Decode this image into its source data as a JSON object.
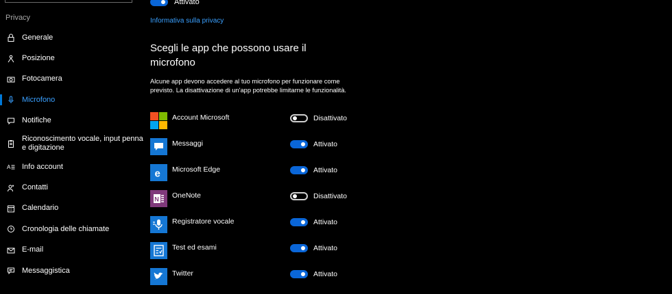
{
  "sidebar": {
    "section_label": "Privacy",
    "items": [
      {
        "label": "Generale",
        "icon": "lock-icon"
      },
      {
        "label": "Posizione",
        "icon": "location-person-icon"
      },
      {
        "label": "Fotocamera",
        "icon": "camera-icon"
      },
      {
        "label": "Microfono",
        "icon": "microphone-icon",
        "active": true
      },
      {
        "label": "Notifiche",
        "icon": "notifications-icon"
      },
      {
        "label": "Riconoscimento vocale, input penna e digitazione",
        "icon": "clipboard-icon"
      },
      {
        "label": "Info account",
        "icon": "account-info-icon"
      },
      {
        "label": "Contatti",
        "icon": "contacts-icon"
      },
      {
        "label": "Calendario",
        "icon": "calendar-icon"
      },
      {
        "label": "Cronologia delle chiamate",
        "icon": "call-history-icon"
      },
      {
        "label": "E-mail",
        "icon": "mail-icon"
      },
      {
        "label": "Messaggistica",
        "icon": "messaging-icon"
      }
    ]
  },
  "main": {
    "top_toggle": {
      "state": "on",
      "label": "Attivato"
    },
    "privacy_link": "Informativa sulla privacy",
    "heading": "Scegli le app che possono usare il microfono",
    "description": "Alcune app devono accedere al tuo microfono per funzionare come previsto. La disattivazione di un'app potrebbe limitarne le funzionalità.",
    "apps": [
      {
        "name": "Account Microsoft",
        "state": "off",
        "status": "Disattivato",
        "icon": "microsoft-logo-icon"
      },
      {
        "name": "Messaggi",
        "state": "on",
        "status": "Attivato",
        "icon": "messages-icon"
      },
      {
        "name": "Microsoft Edge",
        "state": "on",
        "status": "Attivato",
        "icon": "edge-icon"
      },
      {
        "name": "OneNote",
        "state": "off",
        "status": "Disattivato",
        "icon": "onenote-icon"
      },
      {
        "name": "Registratore vocale",
        "state": "on",
        "status": "Attivato",
        "icon": "voice-recorder-icon"
      },
      {
        "name": "Test ed esami",
        "state": "on",
        "status": "Attivato",
        "icon": "take-a-test-icon"
      },
      {
        "name": "Twitter",
        "state": "on",
        "status": "Attivato",
        "icon": "twitter-icon"
      }
    ]
  },
  "colors": {
    "background": "#000000",
    "accent": "#0078d7",
    "link": "#3aa0ff"
  }
}
